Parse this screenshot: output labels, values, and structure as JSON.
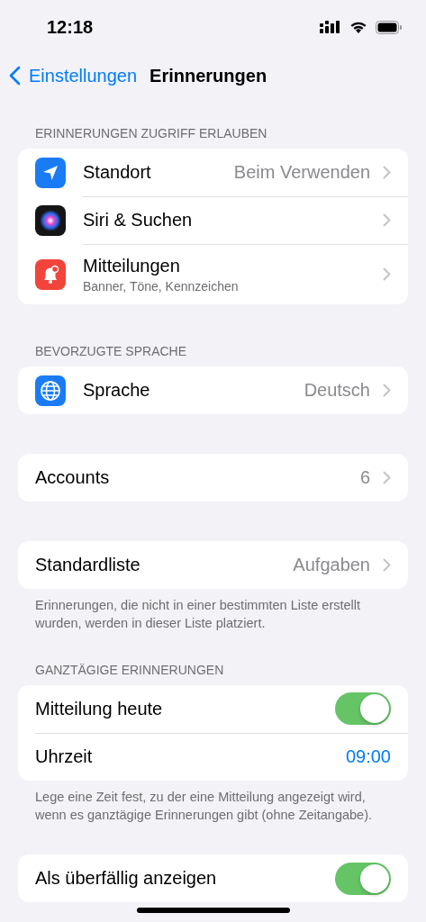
{
  "status_bar": {
    "time": "12:18"
  },
  "nav": {
    "back": "Einstellungen",
    "title": "Erinnerungen"
  },
  "sections": [
    {
      "header": "ERINNERUNGEN ZUGRIFF ERLAUBEN",
      "rows": [
        {
          "kind": "link",
          "label": "Standort",
          "value": "Beim Verwenden"
        },
        {
          "kind": "link",
          "label": "Siri & Suchen"
        },
        {
          "kind": "link",
          "label": "Mitteilungen",
          "subtitle": "Banner, Töne, Kennzeichen"
        }
      ]
    },
    {
      "header": "BEVORZUGTE SPRACHE",
      "rows": [
        {
          "kind": "link",
          "label": "Sprache",
          "value": "Deutsch"
        }
      ]
    },
    {
      "rows": [
        {
          "kind": "link",
          "label": "Accounts",
          "value": "6"
        }
      ]
    },
    {
      "rows": [
        {
          "kind": "link",
          "label": "Standardliste",
          "value": "Aufgaben"
        }
      ],
      "footer": "Erinnerungen, die nicht in einer bestimmten Liste erstellt wurden, werden in dieser Liste platziert."
    },
    {
      "header": "GANZTÄGIGE ERINNERUNGEN",
      "rows": [
        {
          "kind": "toggle",
          "label": "Mitteilung heute",
          "on": true
        },
        {
          "kind": "time",
          "label": "Uhrzeit",
          "value": "09:00"
        }
      ],
      "footer": "Lege eine Zeit fest, zu der eine Mitteilung angezeigt wird, wenn es ganztägige Erinnerungen gibt (ohne Zeitangabe)."
    },
    {
      "rows": [
        {
          "kind": "toggle",
          "label": "Als überfällig anzeigen",
          "on": true
        }
      ]
    }
  ]
}
